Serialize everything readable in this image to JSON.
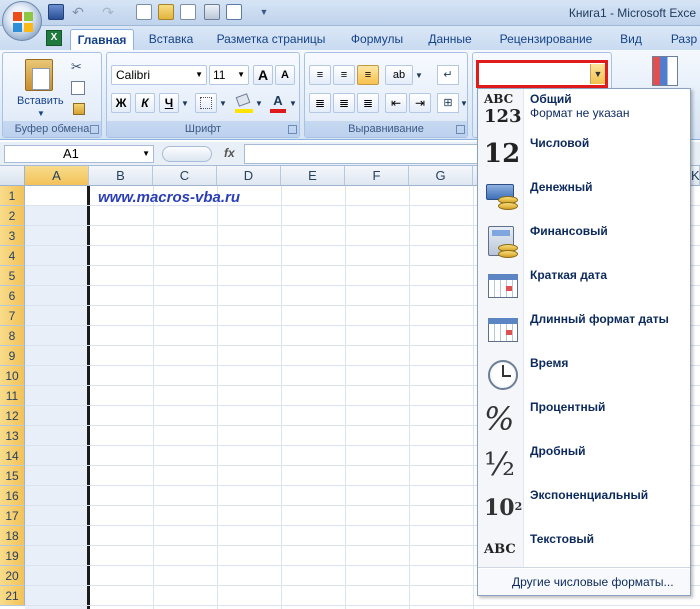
{
  "app": {
    "title": "Книга1 - Microsoft Exce"
  },
  "tabs": [
    "Главная",
    "Вставка",
    "Разметка страницы",
    "Формулы",
    "Данные",
    "Рецензирование",
    "Вид",
    "Разр"
  ],
  "ribbon": {
    "paste_label": "Вставить",
    "clipboard_group": "Буфер обмена",
    "font_group": "Шрифт",
    "align_group": "Выравнивание",
    "font_name": "Calibri",
    "font_size": "11",
    "bold": "Ж",
    "italic": "К",
    "underline": "Ч",
    "grow_font": "A",
    "shrink_font": "A",
    "font_color_letter": "A",
    "number_format_value": ""
  },
  "formula": {
    "cell_ref": "A1",
    "fx": "fx"
  },
  "grid": {
    "columns": [
      "A",
      "B",
      "C",
      "D",
      "E",
      "F",
      "G",
      "K"
    ],
    "rows": [
      "1",
      "2",
      "3",
      "4",
      "5",
      "6",
      "7",
      "8",
      "9",
      "10",
      "11",
      "12",
      "13",
      "14",
      "15",
      "16",
      "17",
      "18",
      "19",
      "20",
      "21"
    ],
    "cell_b1": "www.macros-vba.ru"
  },
  "dropdown": {
    "items": [
      {
        "label": "Общий",
        "sub": "Формат не указан",
        "icon": "general-icon",
        "icon_text_top": "ABC",
        "icon_text_bottom": "123"
      },
      {
        "label": "Числовой",
        "icon": "number-icon",
        "icon_text": "12"
      },
      {
        "label": "Денежный",
        "icon": "currency-icon"
      },
      {
        "label": "Финансовый",
        "icon": "accounting-icon"
      },
      {
        "label": "Краткая дата",
        "icon": "short-date-icon"
      },
      {
        "label": "Длинный формат даты",
        "icon": "long-date-icon"
      },
      {
        "label": "Время",
        "icon": "clock-icon"
      },
      {
        "label": "Процентный",
        "icon": "percent-icon",
        "icon_text": "%"
      },
      {
        "label": "Дробный",
        "icon": "fraction-icon",
        "icon_text": "½"
      },
      {
        "label": "Экспоненциальный",
        "icon": "scientific-icon",
        "icon_text": "10",
        "icon_sup": "2"
      },
      {
        "label": "Текстовый",
        "icon": "text-icon",
        "icon_text": "ABC"
      }
    ],
    "more": "Другие числовые форматы..."
  },
  "colors": {
    "accent": "#15428b",
    "selection": "#e01b1b",
    "link": "#2a3fb6"
  }
}
